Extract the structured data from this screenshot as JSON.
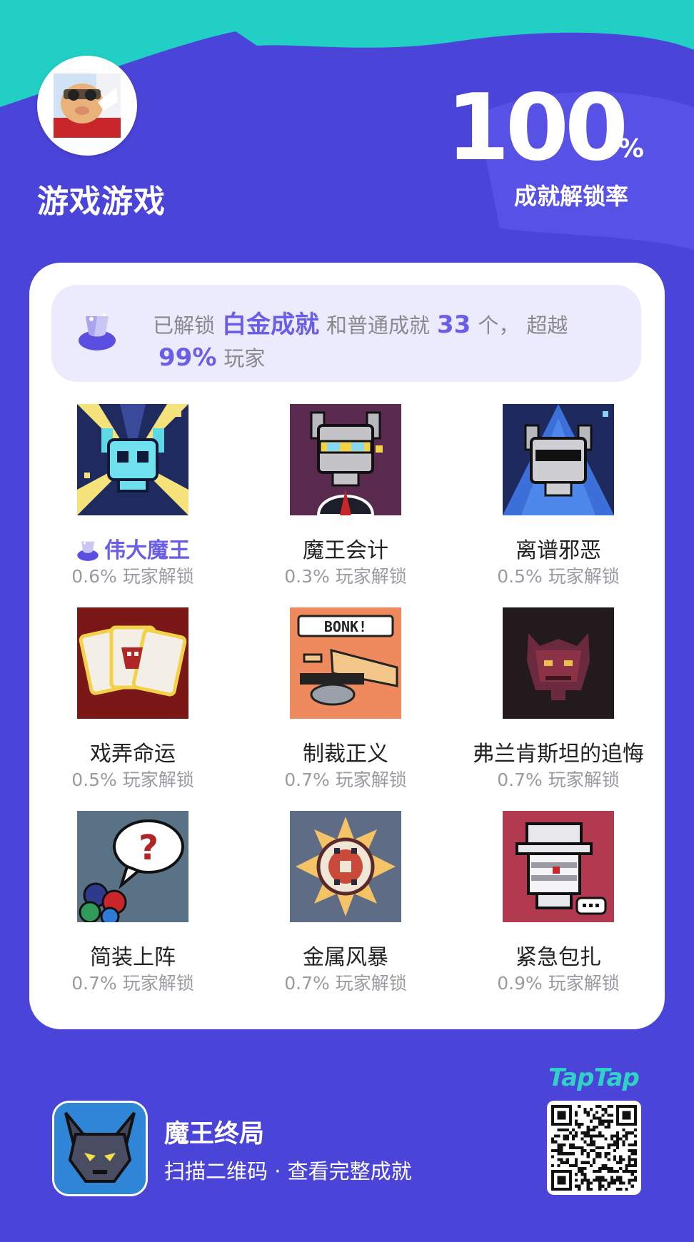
{
  "profile": {
    "username": "游戏游戏",
    "avatar_icon": "avatar-image"
  },
  "stats": {
    "unlock_rate": "100",
    "unlock_rate_unit": "%",
    "unlock_rate_label": "成就解锁率"
  },
  "summary": {
    "prefix": "已解锁",
    "platinum": "白金成就",
    "middle": "和普通成就",
    "count": "33",
    "count_suffix": "个，",
    "beyond": "超越",
    "percent": "99%",
    "players": "玩家"
  },
  "achievements": [
    {
      "name": "伟大魔王",
      "rate": "0.6% 玩家解锁",
      "platinum": true,
      "icon": "horned-skull-icon"
    },
    {
      "name": "魔王会计",
      "rate": "0.3% 玩家解锁",
      "icon": "accountant-skull-icon"
    },
    {
      "name": "离谱邪恶",
      "rate": "0.5% 玩家解锁",
      "icon": "sunglasses-skull-icon"
    },
    {
      "name": "戏弄命运",
      "rate": "0.5% 玩家解锁",
      "icon": "cards-icon"
    },
    {
      "name": "制裁正义",
      "rate": "0.7% 玩家解锁",
      "icon": "bonk-hammer-icon"
    },
    {
      "name": "弗兰肯斯坦的追悔",
      "rate": "0.7% 玩家解锁",
      "icon": "dark-demon-icon"
    },
    {
      "name": "简装上阵",
      "rate": "0.7% 玩家解锁",
      "icon": "question-bubble-icon"
    },
    {
      "name": "金属风暴",
      "rate": "0.7% 玩家解锁",
      "icon": "metal-sun-icon"
    },
    {
      "name": "紧急包扎",
      "rate": "0.9% 玩家解锁",
      "icon": "bandaged-mummy-icon"
    }
  ],
  "game": {
    "title": "魔王终局",
    "subtitle": "扫描二维码 · 查看完整成就",
    "platform": "TapTap"
  },
  "colors": {
    "background": "#4b44d9",
    "teal": "#22cfc4",
    "accent": "#6a5ee8"
  }
}
